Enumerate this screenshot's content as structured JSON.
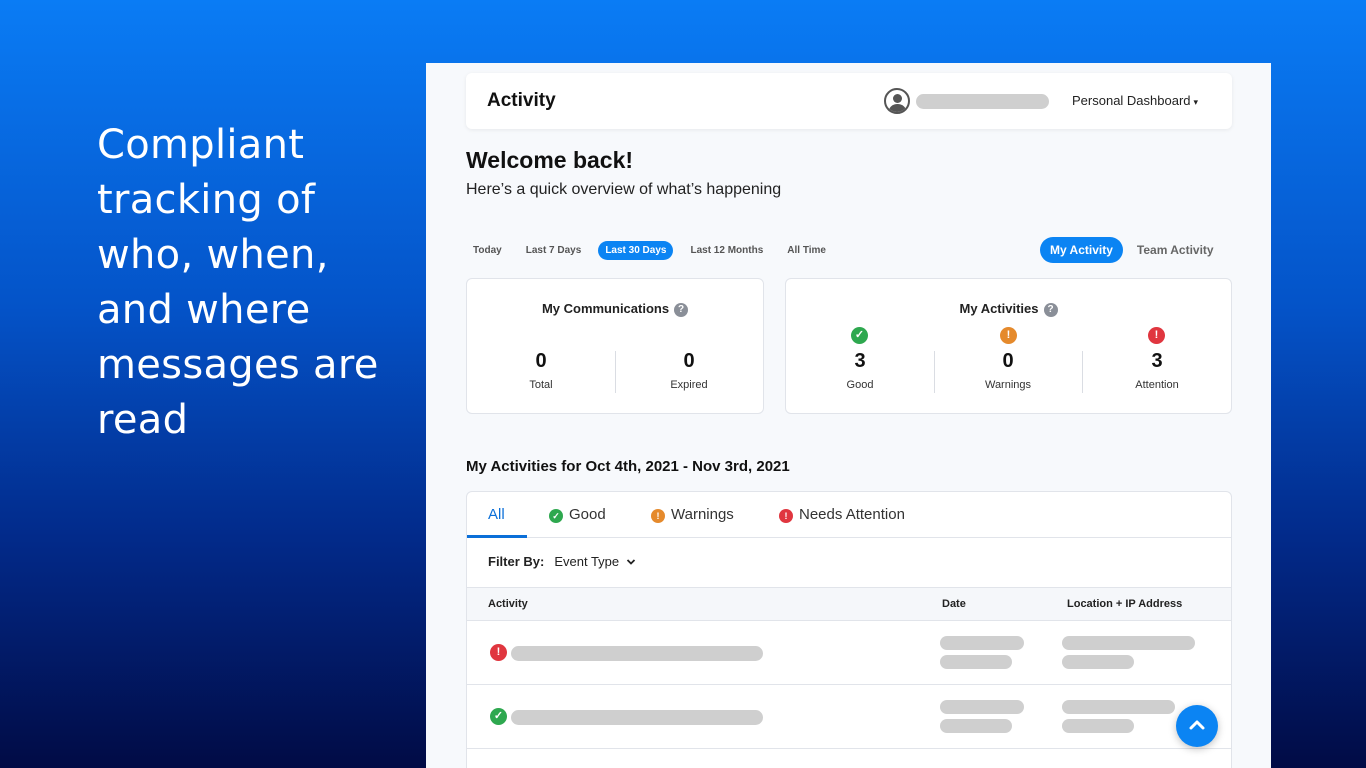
{
  "tagline": "Compliant tracking of who, when, and where messages are read",
  "header": {
    "title": "Activity",
    "dashboard_menu": "Personal Dashboard",
    "dashboard_caret": "▾"
  },
  "welcome": {
    "heading": "Welcome back!",
    "subheading": "Here’s a quick overview of what’s happening"
  },
  "ranges": [
    "Today",
    "Last 7 Days",
    "Last 30 Days",
    "Last 12 Months",
    "All Time"
  ],
  "active_range": "Last 30 Days",
  "scope": {
    "my_activity": "My Activity",
    "team_activity": "Team Activity"
  },
  "communications": {
    "title": "My Communications",
    "help": "?",
    "total_value": "0",
    "total_label": "Total",
    "expired_value": "0",
    "expired_label": "Expired"
  },
  "activities": {
    "title": "My Activities",
    "help": "?",
    "good_value": "3",
    "good_label": "Good",
    "warnings_value": "0",
    "warnings_label": "Warnings",
    "attention_value": "3",
    "attention_label": "Attention"
  },
  "list": {
    "title": "My Activities for Oct 4th, 2021 - Nov 3rd, 2021",
    "tabs": {
      "all": "All",
      "good": "Good",
      "warnings": "Warnings",
      "needs_attention": "Needs Attention"
    },
    "filter_label": "Filter By:",
    "filter_value": "Event Type",
    "columns": {
      "activity": "Activity",
      "date": "Date",
      "location": "Location + IP Address"
    }
  },
  "icons": {
    "good": "check-circle-icon",
    "warning": "exclamation-circle-icon",
    "attention": "alert-circle-icon",
    "help": "question-circle-icon",
    "scroll_top": "chevron-up-icon",
    "user": "user-avatar-icon"
  },
  "colors": {
    "accent": "#0b84f3",
    "good": "#2ea84f",
    "warning": "#e58a2c",
    "attention": "#e0363f"
  }
}
